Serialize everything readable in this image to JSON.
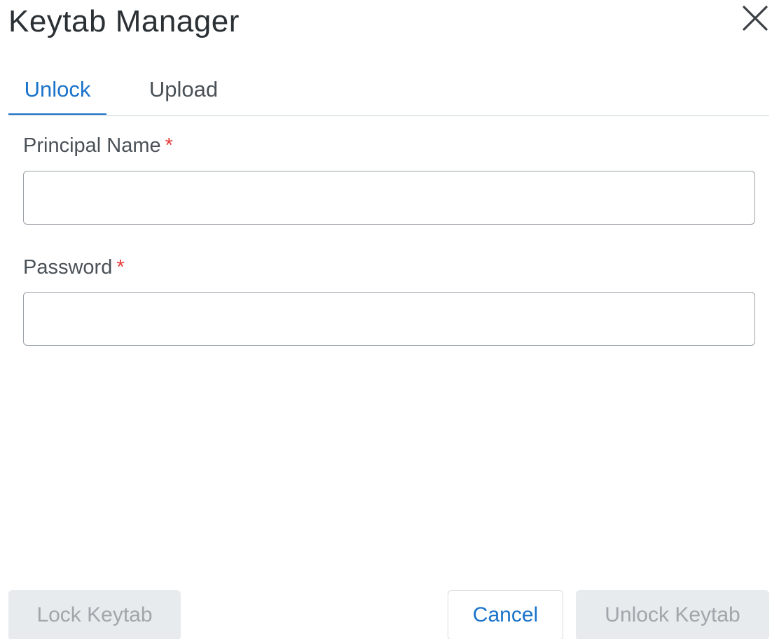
{
  "dialog": {
    "title": "Keytab Manager",
    "close_icon": "close-icon"
  },
  "tabs": [
    {
      "label": "Unlock",
      "active": true
    },
    {
      "label": "Upload",
      "active": false
    }
  ],
  "form": {
    "principal": {
      "label": "Principal Name",
      "required_mark": "*",
      "value": "",
      "placeholder": ""
    },
    "password": {
      "label": "Password",
      "required_mark": "*",
      "value": "",
      "placeholder": ""
    }
  },
  "footer": {
    "lock_label": "Lock Keytab",
    "cancel_label": "Cancel",
    "unlock_label": "Unlock Keytab"
  },
  "colors": {
    "accent": "#1a73c9",
    "required": "#e53935",
    "disabled_bg": "#e8ebed",
    "disabled_text": "#a0a6ab"
  }
}
